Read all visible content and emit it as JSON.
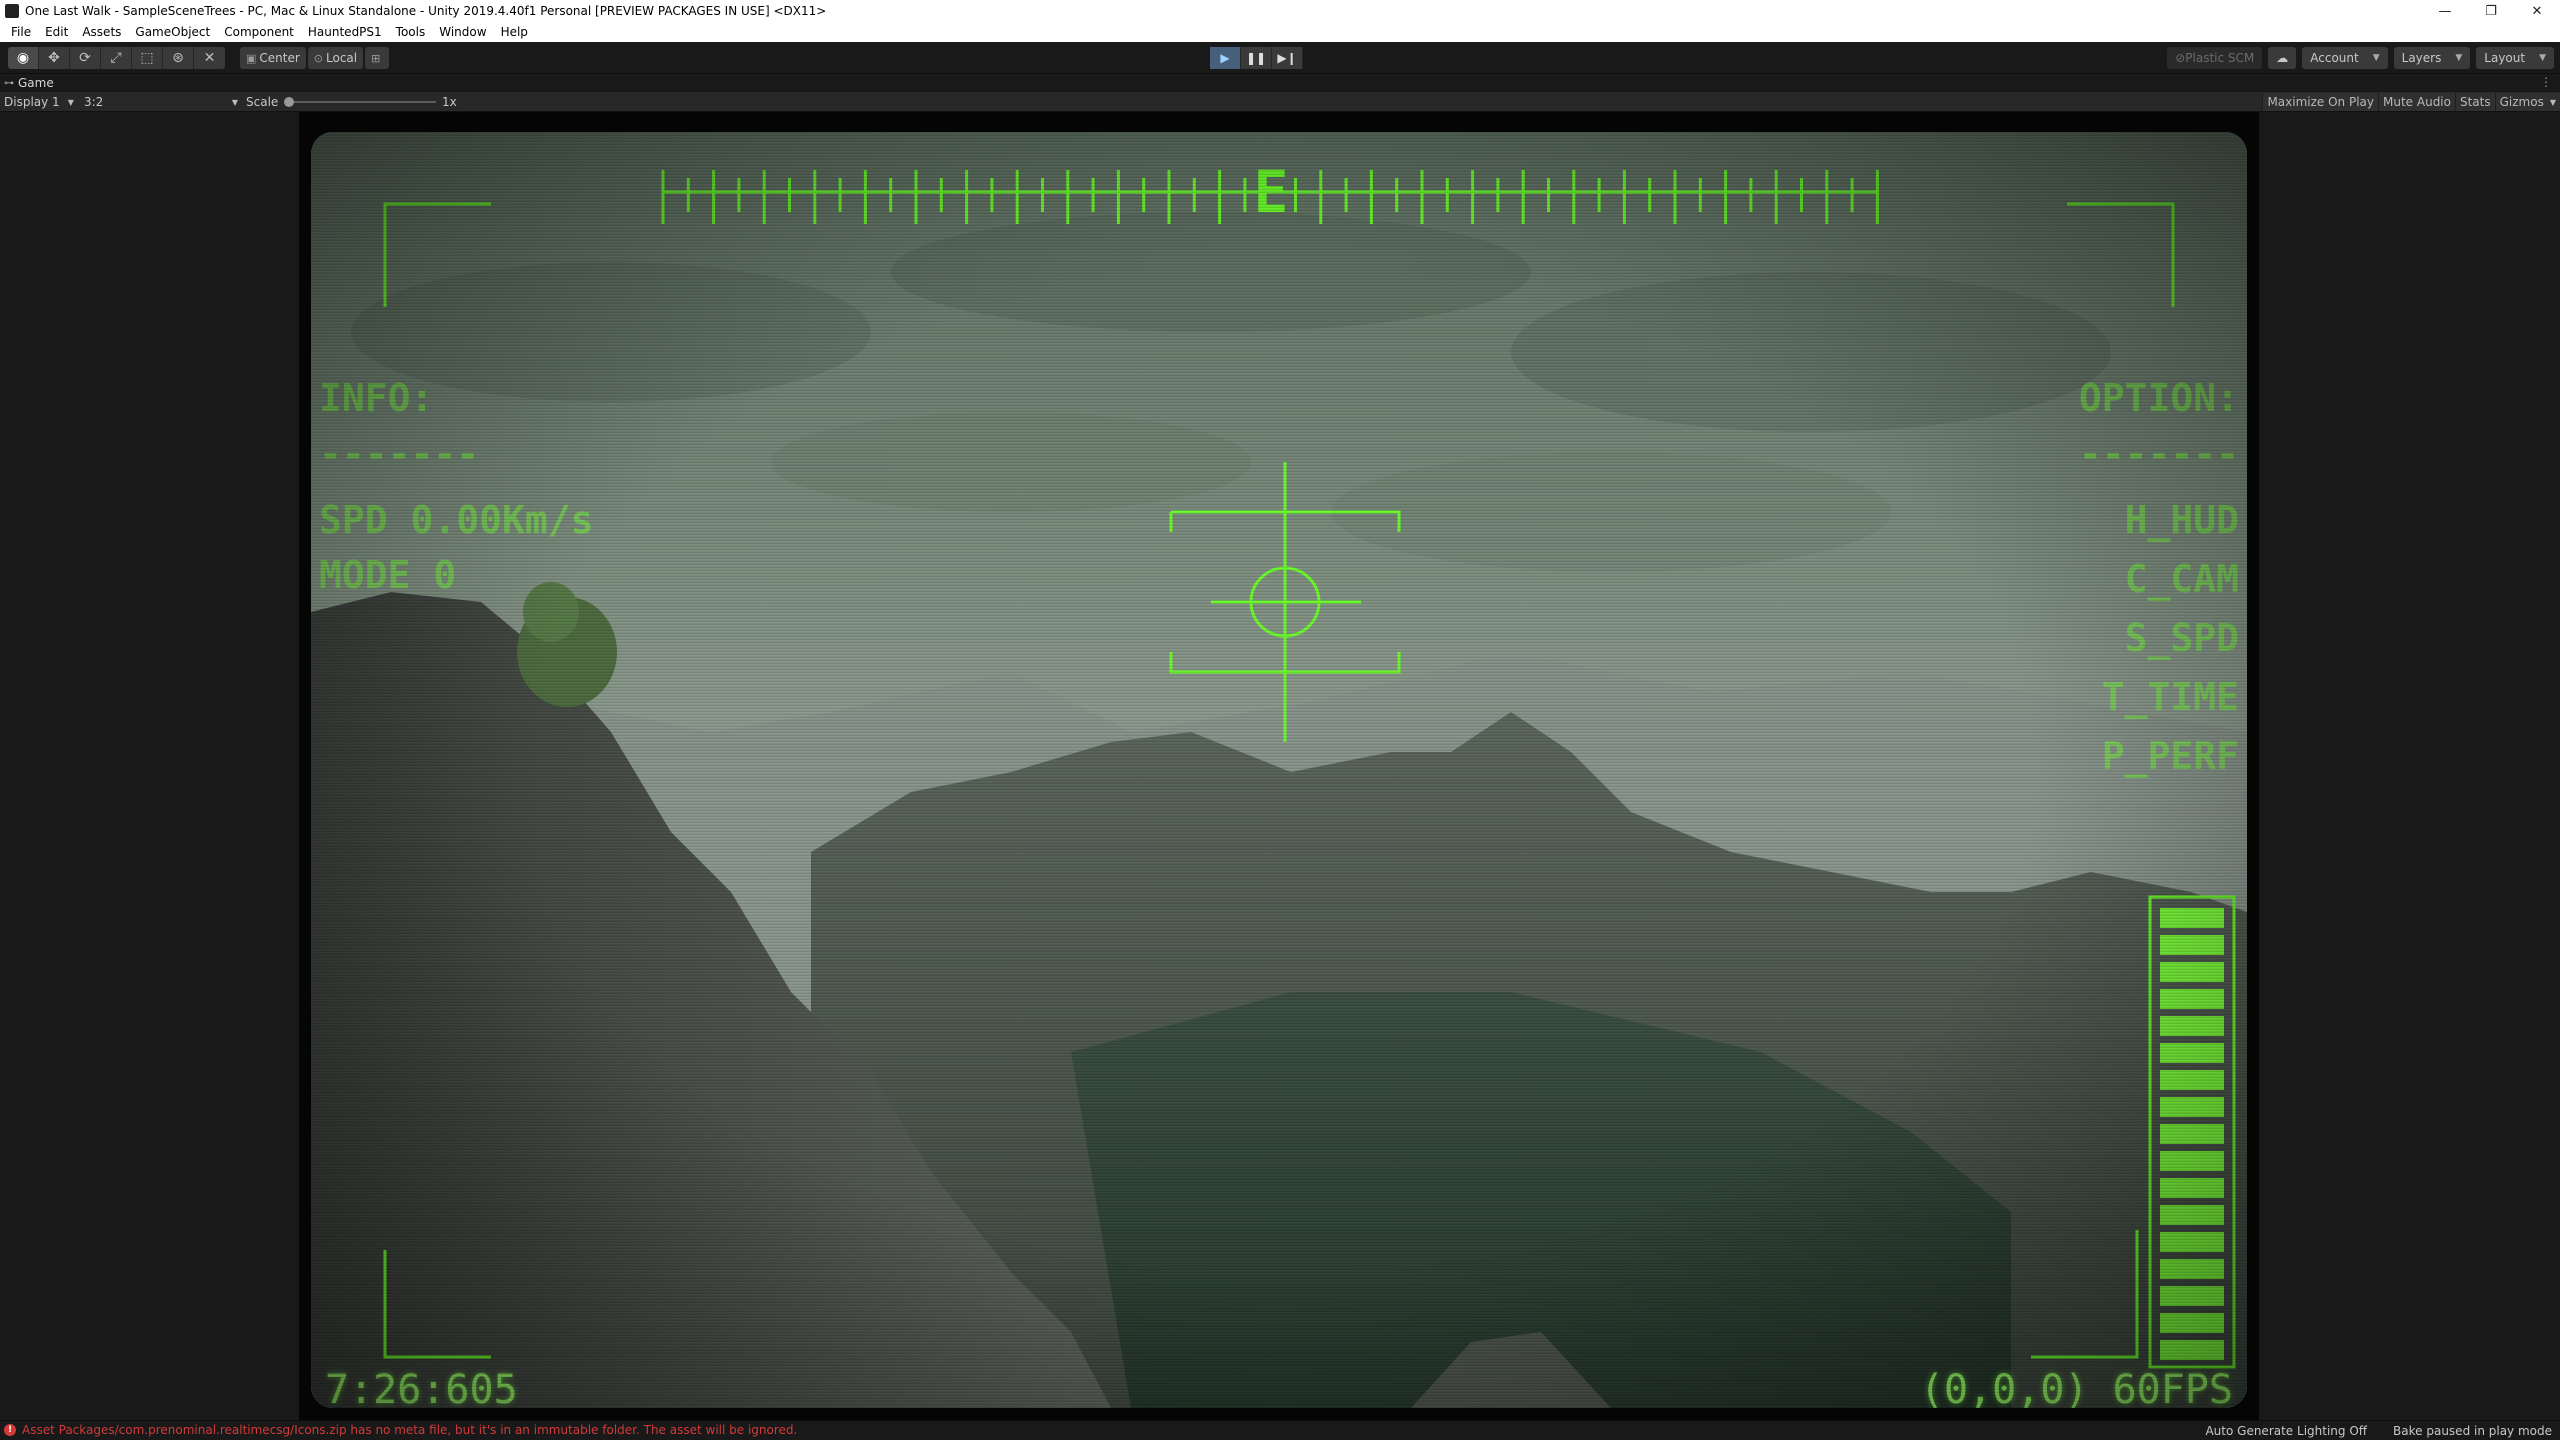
{
  "window": {
    "title": "One Last Walk - SampleSceneTrees - PC, Mac & Linux Standalone - Unity 2019.4.40f1 Personal [PREVIEW PACKAGES IN USE] <DX11>",
    "minimize": "—",
    "restore": "❐",
    "close": "✕"
  },
  "menu": [
    "File",
    "Edit",
    "Assets",
    "GameObject",
    "Component",
    "HauntedPS1",
    "Tools",
    "Window",
    "Help"
  ],
  "toolbar": {
    "pivot_label": "Center",
    "rotation_label": "Local",
    "plastic_label": "Plastic SCM",
    "account_label": "Account",
    "layers_label": "Layers",
    "layout_label": "Layout"
  },
  "game_tab": {
    "label": "Game",
    "display_label": "Display 1",
    "aspect_label": "3:2",
    "scale_label": "Scale",
    "scale_value": "1x",
    "maximize_label": "Maximize On Play",
    "mute_label": "Mute Audio",
    "stats_label": "Stats",
    "gizmos_label": "Gizmos"
  },
  "hud": {
    "compass_letter": "E",
    "info_label": "INFO:",
    "info_rule": "-------",
    "speed": "SPD 0.00Km/s",
    "mode": "MODE 0",
    "option_label": "OPTION:",
    "option_rule": "-------",
    "options": [
      "H_HUD",
      "C_CAM",
      "S_SPD",
      "T_TIME",
      "P_PERF"
    ],
    "time": "7:26:605",
    "position_fps": "(0,0,0) 60FPS"
  },
  "status": {
    "message": "Asset Packages/com.prenominal.realtimecsg/Icons.zip has no meta file, but it's in an immutable folder. The asset will be ignored.",
    "lighting": "Auto Generate Lighting Off",
    "bake": "Bake paused in play mode"
  },
  "colors": {
    "hud_green": "#6bff2a",
    "error_red": "#d23a3a",
    "play_active": "#46607c"
  }
}
